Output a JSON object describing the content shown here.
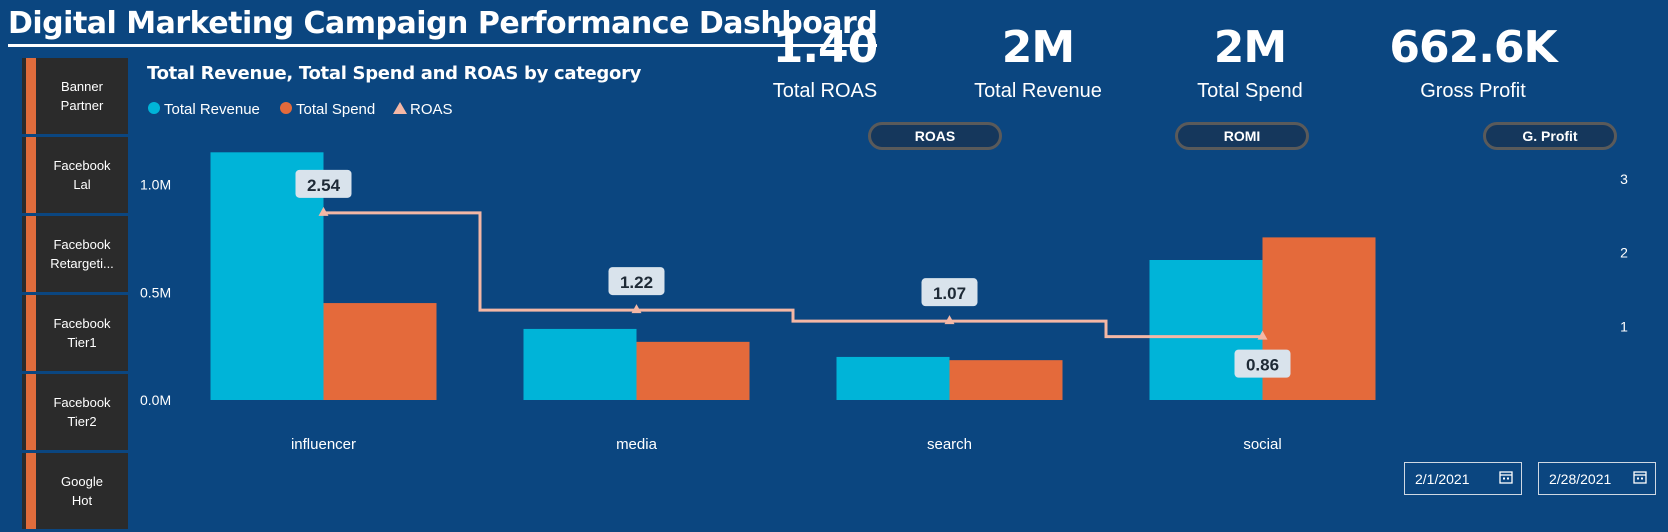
{
  "page": {
    "title": "Digital Marketing Campaign Performance Dashboard"
  },
  "slicer": {
    "items": [
      {
        "label": "Banner\nPartner"
      },
      {
        "label": "Facebook\nLal"
      },
      {
        "label": "Facebook\nRetargeti..."
      },
      {
        "label": "Facebook\nTier1"
      },
      {
        "label": "Facebook\nTier2"
      },
      {
        "label": "Google\nHot"
      }
    ]
  },
  "kpis": [
    {
      "value": "1.40",
      "label": "Total ROAS"
    },
    {
      "value": "2M",
      "label": "Total Revenue"
    },
    {
      "value": "2M",
      "label": "Total Spend"
    },
    {
      "value": "662.6K",
      "label": "Gross Profit"
    }
  ],
  "buttons": {
    "roas": "ROAS",
    "romi": "ROMI",
    "gprofit": "G. Profit"
  },
  "dates": {
    "start": "2/1/2021",
    "end": "2/28/2021"
  },
  "colors": {
    "revenue": "#00b4d8",
    "spend": "#e46a3b",
    "roas": "#f4b7a5",
    "background": "#0b4680"
  },
  "chart_data": {
    "type": "bar",
    "title": "Total Revenue, Total Spend and ROAS by category",
    "categories": [
      "influencer",
      "media",
      "search",
      "social"
    ],
    "series": [
      {
        "name": "Total Revenue",
        "axis": "left",
        "values": [
          1150000,
          330000,
          200000,
          650000
        ]
      },
      {
        "name": "Total Spend",
        "axis": "left",
        "values": [
          450000,
          270000,
          185000,
          755000
        ]
      }
    ],
    "line_series": {
      "name": "ROAS",
      "axis": "right",
      "values": [
        2.54,
        1.22,
        1.07,
        0.86
      ],
      "data_labels": [
        "2.54",
        "1.22",
        "1.07",
        "0.86"
      ]
    },
    "y_left": {
      "ticks": [
        0,
        500000,
        1000000
      ],
      "tick_labels": [
        "0.0M",
        "0.5M",
        "1.0M"
      ],
      "ylim": [
        0,
        1300000
      ]
    },
    "y_right": {
      "ticks": [
        1,
        2,
        3
      ],
      "tick_labels": [
        "1",
        "2",
        "3"
      ],
      "ylim": [
        0,
        3.8
      ]
    },
    "legend_position": "top-left",
    "grid": false
  }
}
